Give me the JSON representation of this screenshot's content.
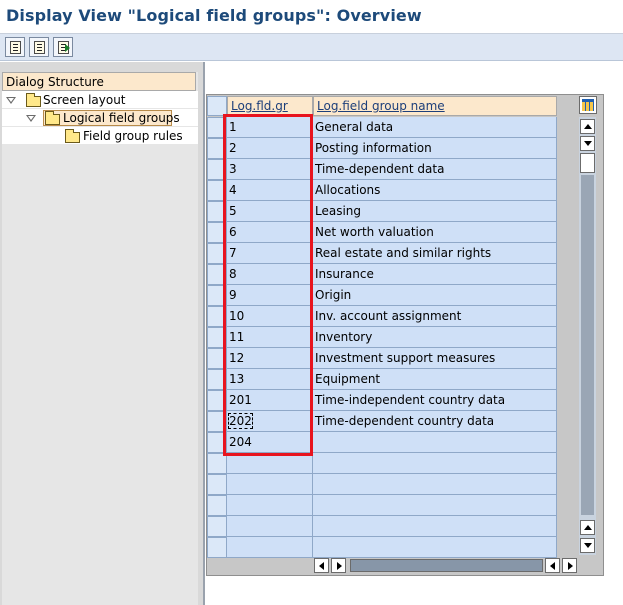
{
  "title": "Display View \"Logical field groups\": Overview",
  "toolbar": {
    "buttons": [
      {
        "name": "details-button",
        "icon": "details-icon"
      },
      {
        "name": "previous-entry-button",
        "icon": "previous-entry-icon"
      },
      {
        "name": "next-entry-button",
        "icon": "next-entry-icon"
      }
    ]
  },
  "dialog_structure": {
    "header": "Dialog Structure",
    "items": [
      {
        "label": "Screen layout",
        "level": 0,
        "expanded": true,
        "selected": false
      },
      {
        "label": "Logical field groups",
        "level": 1,
        "expanded": true,
        "selected": true
      },
      {
        "label": "Field group rules",
        "level": 2,
        "expanded": false,
        "selected": false
      }
    ]
  },
  "table": {
    "columns": [
      "Log.fld.gr",
      "Log.field group name"
    ],
    "rows": [
      [
        "1",
        "General data"
      ],
      [
        "2",
        "Posting information"
      ],
      [
        "3",
        "Time-dependent data"
      ],
      [
        "4",
        "Allocations"
      ],
      [
        "5",
        "Leasing"
      ],
      [
        "6",
        "Net worth valuation"
      ],
      [
        "7",
        "Real estate and similar rights"
      ],
      [
        "8",
        "Insurance"
      ],
      [
        "9",
        "Origin"
      ],
      [
        "10",
        "Inv. account assignment"
      ],
      [
        "11",
        "Inventory"
      ],
      [
        "12",
        "Investment support measures"
      ],
      [
        "13",
        "Equipment"
      ],
      [
        "201",
        "Time-independent country data"
      ],
      [
        "202",
        "Time-dependent country data"
      ],
      [
        "204",
        ""
      ],
      [
        "",
        ""
      ],
      [
        "",
        ""
      ],
      [
        "",
        ""
      ],
      [
        "",
        ""
      ],
      [
        "",
        ""
      ]
    ],
    "focused_row": 14
  },
  "colors": {
    "title": "#1d4a7a",
    "header_bg": "#fce8cc",
    "cell_bg": "#cfe0f7",
    "highlight": "#e8141e"
  }
}
